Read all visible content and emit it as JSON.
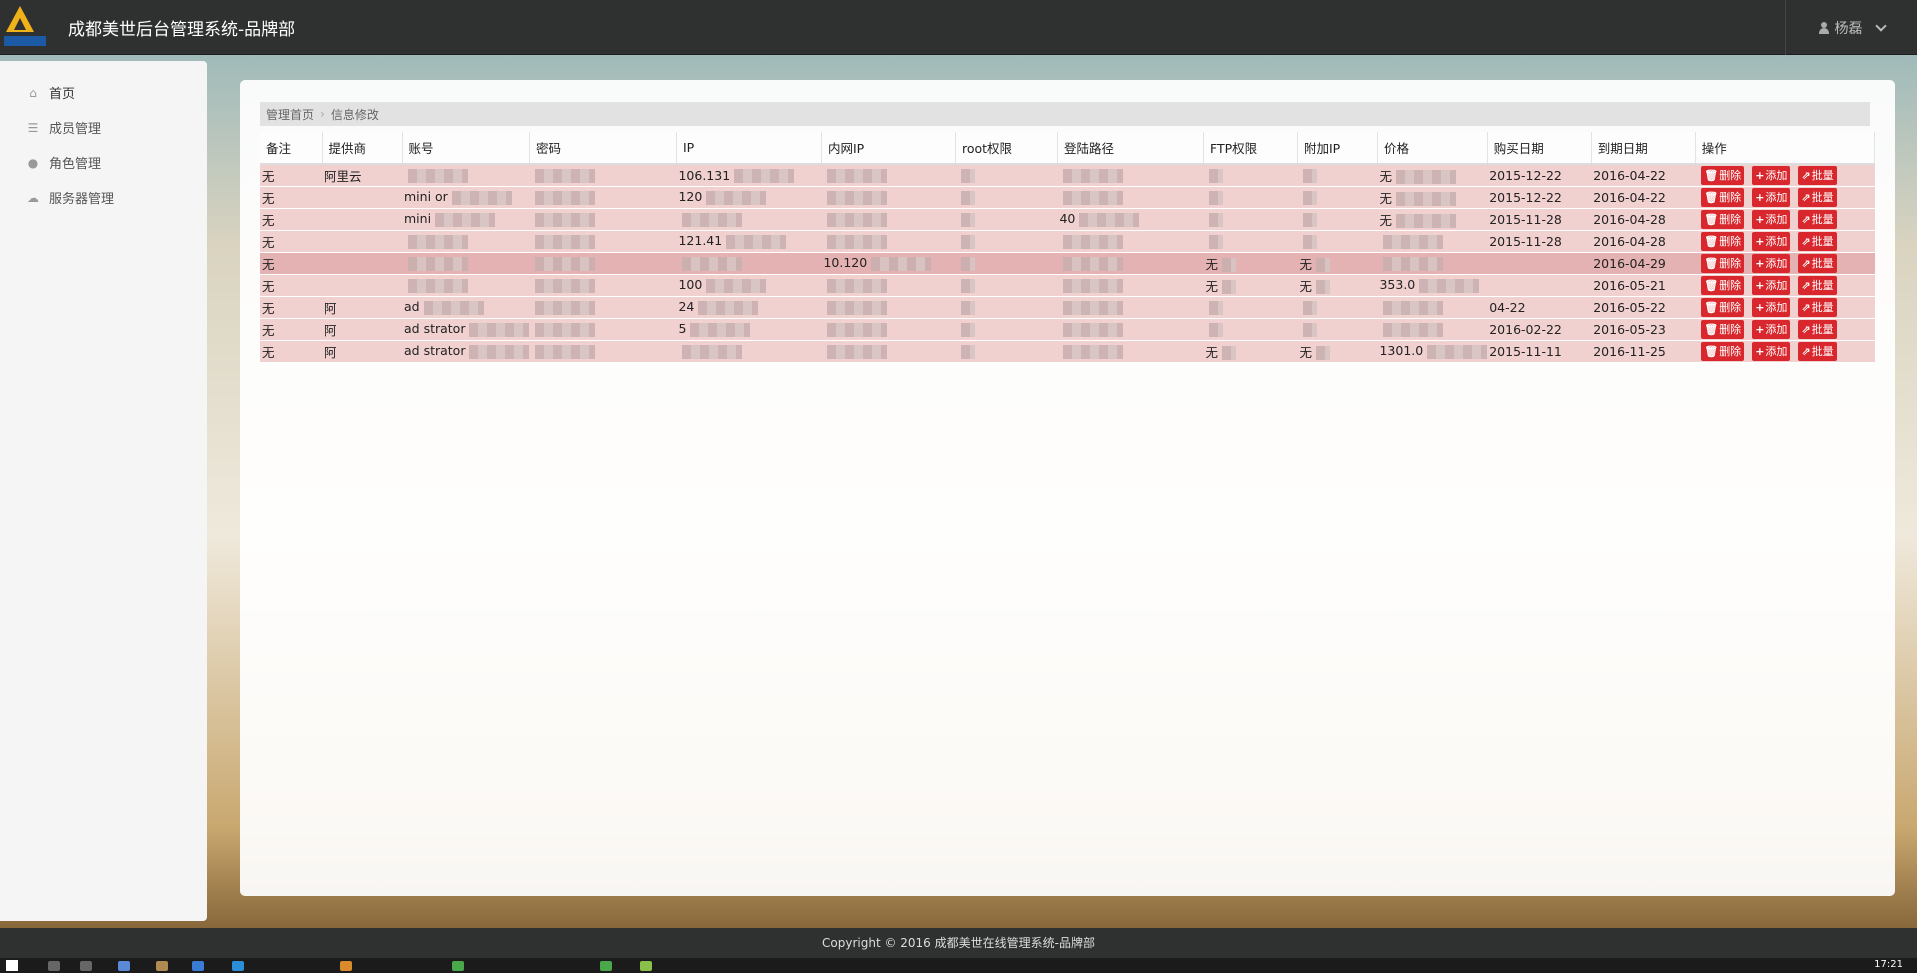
{
  "app": {
    "title": "成都美世后台管理系统-品牌部",
    "user": "杨磊"
  },
  "sidebar": {
    "items": [
      {
        "label": "首页",
        "icon": "home-icon"
      },
      {
        "label": "成员管理",
        "icon": "list-icon"
      },
      {
        "label": "角色管理",
        "icon": "user-icon"
      },
      {
        "label": "服务器管理",
        "icon": "cloud-icon"
      }
    ]
  },
  "breadcrumb": {
    "home": "管理首页",
    "current": "信息修改"
  },
  "table": {
    "columns": [
      "备注",
      "提供商",
      "账号",
      "密码",
      "IP",
      "内网IP",
      "root权限",
      "登陆路径",
      "FTP权限",
      "附加IP",
      "价格",
      "购买日期",
      "到期日期",
      "操作"
    ],
    "rows": [
      {
        "note": "无",
        "provider": "阿里云",
        "account": "",
        "ip": "106.131",
        "inner_ip": "",
        "path": "",
        "ftp": "",
        "extra_ip": "",
        "price": "无",
        "buy": "2015-12-22",
        "expire": "2016-04-22"
      },
      {
        "note": "无",
        "provider": "",
        "account": "mini or",
        "ip": "120",
        "inner_ip": "",
        "path": "",
        "ftp": "",
        "extra_ip": "",
        "price": "无",
        "buy": "2015-12-22",
        "expire": "2016-04-22"
      },
      {
        "note": "无",
        "provider": "",
        "account": "mini",
        "ip": "",
        "inner_ip": "",
        "path": "40",
        "ftp": "",
        "extra_ip": "",
        "price": "无",
        "buy": "2015-11-28",
        "expire": "2016-04-28"
      },
      {
        "note": "无",
        "provider": "",
        "account": "",
        "ip": "121.41",
        "inner_ip": "",
        "path": "",
        "ftp": "",
        "extra_ip": "",
        "price": "",
        "buy": "2015-11-28",
        "expire": "2016-04-28"
      },
      {
        "note": "无",
        "provider": "",
        "account": "",
        "ip": "",
        "inner_ip": "10.120",
        "path": "",
        "ftp": "无",
        "extra_ip": "无",
        "price": "",
        "buy": "",
        "expire": "2016-04-29"
      },
      {
        "note": "无",
        "provider": "",
        "account": "",
        "ip": "100",
        "inner_ip": "",
        "path": "",
        "ftp": "无",
        "extra_ip": "无",
        "price": "353.0",
        "buy": "",
        "expire": "2016-05-21"
      },
      {
        "note": "无",
        "provider": "阿",
        "account": "ad",
        "ip": "24",
        "inner_ip": "",
        "path": "",
        "ftp": "",
        "extra_ip": "",
        "price": "",
        "buy": "04-22",
        "expire": "2016-05-22"
      },
      {
        "note": "无",
        "provider": "阿",
        "account": "ad strator",
        "ip": "5",
        "inner_ip": "",
        "path": "",
        "ftp": "",
        "extra_ip": "",
        "price": "",
        "buy": "2016-02-22",
        "expire": "2016-05-23"
      },
      {
        "note": "无",
        "provider": "阿",
        "account": "ad strator",
        "ip": "",
        "inner_ip": "",
        "path": "",
        "ftp": "无",
        "extra_ip": "无",
        "price": "1301.0",
        "buy": "2015-11-11",
        "expire": "2016-11-25"
      }
    ],
    "ops": {
      "delete": "删除",
      "add": "添加",
      "batch": "批量"
    }
  },
  "footer": {
    "copyright": "Copyright © 2016 成都美世在线管理系统-品牌部"
  },
  "taskbar": {
    "time": "17:21"
  }
}
